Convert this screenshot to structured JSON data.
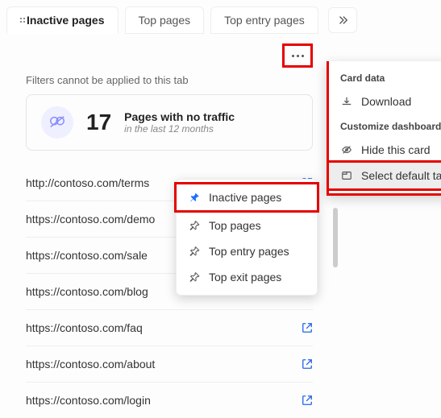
{
  "tabs": {
    "active": "Inactive pages",
    "items": [
      "Inactive pages",
      "Top pages",
      "Top entry pages"
    ]
  },
  "filter_note": "Filters cannot be applied to this tab",
  "stat": {
    "number": "17",
    "title": "Pages with no traffic",
    "subtitle": "in the last 12 months"
  },
  "urls": [
    "http://contoso.com/terms",
    "https://contoso.com/demo",
    "https://contoso.com/sale",
    "https://contoso.com/blog",
    "https://contoso.com/faq",
    "https://contoso.com/about",
    "https://contoso.com/login"
  ],
  "main_menu": {
    "section1_label": "Card data",
    "download": "Download",
    "section2_label": "Customize dashboard",
    "hide": "Hide this card",
    "select_default": "Select default tab"
  },
  "sub_menu": {
    "items": [
      "Inactive pages",
      "Top pages",
      "Top entry pages",
      "Top exit pages"
    ]
  }
}
